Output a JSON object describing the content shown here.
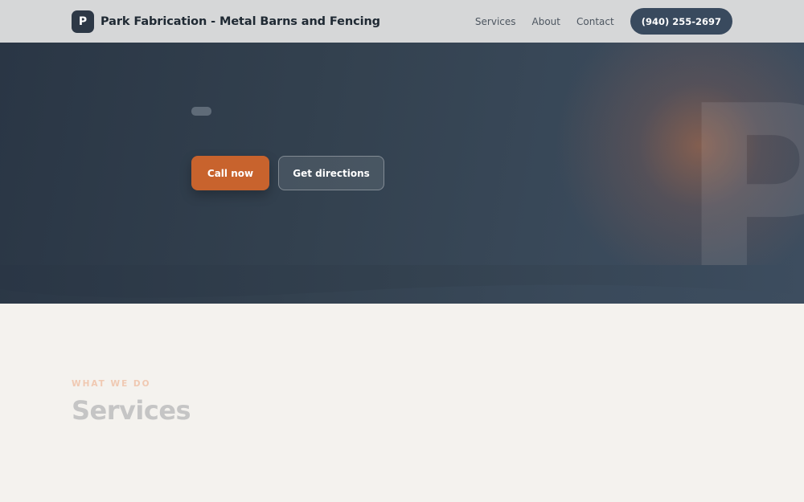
{
  "header": {
    "logo_letter": "P",
    "brand": "Park Fabrication - Metal Barns and Fencing",
    "nav": [
      "Services",
      "About",
      "Contact"
    ],
    "phone": "(940) 255-2697"
  },
  "hero": {
    "watermark_letter": "P",
    "call_label": "Call now",
    "directions_label": "Get directions"
  },
  "services": {
    "eyebrow": "WHAT WE DO",
    "title": "Services"
  },
  "colors": {
    "accent": "#c8632d",
    "header_bg": "#d6d7d8",
    "hero_bg": "#33414f",
    "page_bg": "#f4f2ee"
  }
}
